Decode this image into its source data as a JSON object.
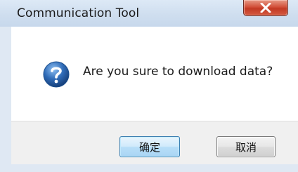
{
  "dialog": {
    "title": "Communication Tool",
    "message": "Are you sure to download data?",
    "icon": "question-icon",
    "buttons": {
      "ok_label": "确定",
      "cancel_label": "取消"
    }
  },
  "titlebar": {
    "close_icon": "close-icon"
  },
  "colors": {
    "titlebar": "#cfdeef",
    "close_button": "#c94a34",
    "icon": "#2f6bb7",
    "ok_button": "#bfe3f9",
    "cancel_button": "#e2e2e2"
  }
}
